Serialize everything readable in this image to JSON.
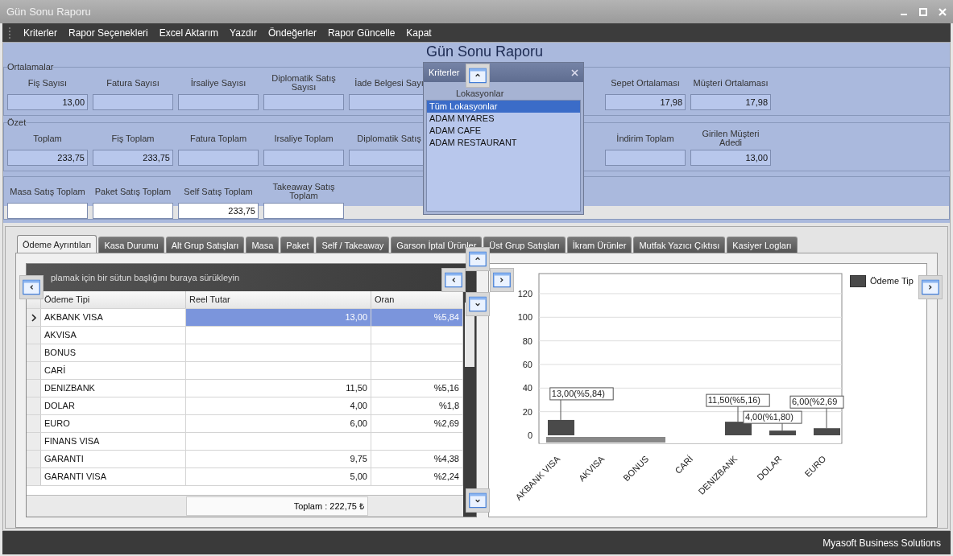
{
  "window": {
    "title": "Gün Sonu Raporu"
  },
  "menu": [
    "Kriterler",
    "Rapor Seçenekleri",
    "Excel Aktarım",
    "Yazdır",
    "Öndeğerler",
    "Rapor Güncelle",
    "Kapat"
  ],
  "report_title": "Gün Sonu Raporu",
  "groups": [
    {
      "title": "Ortalamalar",
      "fields": [
        {
          "label": "Fiş Sayısı",
          "value": "13,00"
        },
        {
          "label": "Fatura Sayısı"
        },
        {
          "label": "İrsaliye Sayısı"
        },
        {
          "label": "Diplomatik Satış Sayısı"
        },
        {
          "label": "İade Belgesi Sayı"
        },
        {
          "kind": "gap"
        },
        {
          "label": "Sepet Ortalaması",
          "value": "17,98"
        },
        {
          "label": "Müşteri Ortalaması",
          "value": "17,98"
        }
      ]
    },
    {
      "title": "Özet",
      "fields": [
        {
          "label": "Toplam",
          "value": "233,75"
        },
        {
          "label": "Fiş Toplam",
          "value": "233,75"
        },
        {
          "label": "Fatura Toplam"
        },
        {
          "label": "Irsaliye Toplam"
        },
        {
          "label": "Diplomatik Satış"
        },
        {
          "kind": "gap"
        },
        {
          "label": "İndirim Toplam"
        },
        {
          "label": "Girilen Müşteri Adedi",
          "value": "13,00"
        }
      ]
    },
    {
      "fields": [
        {
          "label": "Masa Satış Toplam"
        },
        {
          "label": "Paket Satış Toplam"
        },
        {
          "label": "Self Satış Toplam",
          "value": "233,75"
        },
        {
          "label": "Takeaway Satış Toplam"
        }
      ]
    }
  ],
  "criteria_panel": {
    "title": "Kriterler",
    "section": "Lokasyonlar",
    "items": [
      {
        "label": "Tüm Lokasyonlar",
        "selected": true
      },
      {
        "label": "ADAM MYARES",
        "selected": false
      },
      {
        "label": "ADAM CAFE",
        "selected": false
      },
      {
        "label": "ADAM RESTAURANT",
        "selected": false
      }
    ]
  },
  "tabs": [
    {
      "label": "Ödeme Ayrıntıları",
      "selected": true
    },
    {
      "label": "Kasa Durumu",
      "selected": false
    },
    {
      "label": "Alt Grup Satışları",
      "selected": false
    },
    {
      "label": "Masa",
      "selected": false
    },
    {
      "label": "Paket",
      "selected": false
    },
    {
      "label": "Self / Takeaway",
      "selected": false
    },
    {
      "label": "Garson İptal Ürünler",
      "selected": false
    },
    {
      "label": "Üst Grup Satışları",
      "selected": false
    },
    {
      "label": "İkram Ürünler",
      "selected": false
    },
    {
      "label": "Mutfak Yazıcı Çıktısı",
      "selected": false
    },
    {
      "label": "Kasiyer Logları",
      "selected": false
    }
  ],
  "table": {
    "group_hint": "plamak için bir sütun başlığını buraya sürükleyin",
    "columns": [
      "Ödeme Tipi",
      "Reel Tutar",
      "Oran"
    ],
    "rows": [
      {
        "cells": [
          "AKBANK VISA",
          "13,00",
          "%5,84"
        ],
        "selected": true
      },
      {
        "cells": [
          "AKVISA",
          "",
          ""
        ],
        "selected": false
      },
      {
        "cells": [
          "BONUS",
          "",
          ""
        ],
        "selected": false
      },
      {
        "cells": [
          "CARİ",
          "",
          ""
        ],
        "selected": false
      },
      {
        "cells": [
          "DENIZBANK",
          "11,50",
          "%5,16"
        ],
        "selected": false
      },
      {
        "cells": [
          "DOLAR",
          "4,00",
          "%1,8"
        ],
        "selected": false
      },
      {
        "cells": [
          "EURO",
          "6,00",
          "%2,69"
        ],
        "selected": false
      },
      {
        "cells": [
          "FINANS VISA",
          "",
          ""
        ],
        "selected": false
      },
      {
        "cells": [
          "GARANTI",
          "9,75",
          "%4,38"
        ],
        "selected": false
      },
      {
        "cells": [
          "GARANTI VISA",
          "5,00",
          "%2,24"
        ],
        "selected": false
      }
    ],
    "total": "Toplam : 222,75 ₺"
  },
  "chart": {
    "chart_data": {
      "type": "bar",
      "grid": true,
      "categories": [
        "AKBANK VISA",
        "AKVISA",
        "BONUS",
        "CARİ",
        "DENIZBANK",
        "DOLAR",
        "EURO"
      ],
      "series": [
        {
          "name": "Ödeme Tip",
          "color": "#4a4a4a",
          "values": [
            13,
            null,
            null,
            null,
            11.5,
            4,
            6
          ]
        }
      ],
      "ylim": [
        0,
        137
      ],
      "yticks": [
        0,
        20,
        40,
        60,
        80,
        100,
        120
      ],
      "value_labels": [
        "13,00(%5,84)",
        null,
        null,
        null,
        "11,50(%5,16)",
        "4,00(%1,80)",
        "6,00(%2,69"
      ]
    }
  },
  "status_bar": "Myasoft Business Solutions"
}
